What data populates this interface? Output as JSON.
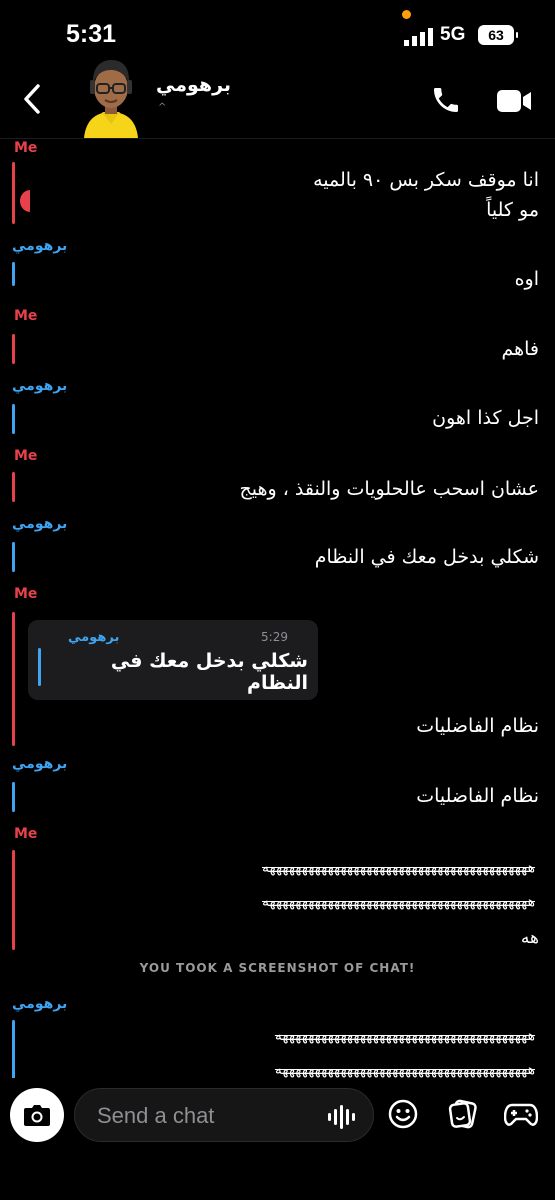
{
  "status": {
    "time": "5:31",
    "network": "5G",
    "battery": "63"
  },
  "header": {
    "contact_name": "برهومي",
    "contact_sub": "^"
  },
  "messages": [
    {
      "sender": "Me",
      "lines": [
        "انا موقف سكر بس ٩٠ بالميه",
        "مو كلياً"
      ]
    },
    {
      "sender": "برهومي",
      "lines": [
        "اوه"
      ]
    },
    {
      "sender": "Me",
      "lines": [
        "فاهم"
      ]
    },
    {
      "sender": "برهومي",
      "lines": [
        "اجل كذا اهون"
      ]
    },
    {
      "sender": "Me",
      "lines": [
        "عشان اسحب عالحلويات والنقذ ، وهيج"
      ]
    },
    {
      "sender": "برهومي",
      "lines": [
        "شكلي بدخل معك في النظام"
      ]
    },
    {
      "sender": "Me",
      "quote": {
        "sender": "برهومي",
        "time": "5:29",
        "text": "شكلي بدخل معك في النظام"
      },
      "lines": [
        "نظام الفاضليات"
      ]
    },
    {
      "sender": "برهومي",
      "lines": [
        "نظام الفاضليات"
      ]
    },
    {
      "sender": "Me",
      "lines": [
        "هههههههههههههههههههههههههههههههههههههههههه",
        "هههههههههههههههههههههههههههههههههههههههههه",
        "هه"
      ]
    },
    {
      "sender": "برهومي",
      "lines": [
        "هههههههههههههههههههههههههههههههههههههههه",
        "هههههههههههههههههههههههههههههههههههههههه"
      ]
    }
  ],
  "notice": "YOU TOOK A SCREENSHOT OF CHAT!",
  "composer": {
    "placeholder": "Send a chat"
  },
  "icons": {
    "back": "chevron-left-icon",
    "call": "phone-icon",
    "video": "video-camera-icon",
    "camera": "camera-icon",
    "mic": "voice-wave-icon",
    "emoji": "smiley-icon",
    "sticker": "sticker-icon",
    "game": "gamepad-icon"
  },
  "colors": {
    "me": "#e8414c",
    "them": "#3fa5f3",
    "background": "#000000"
  }
}
